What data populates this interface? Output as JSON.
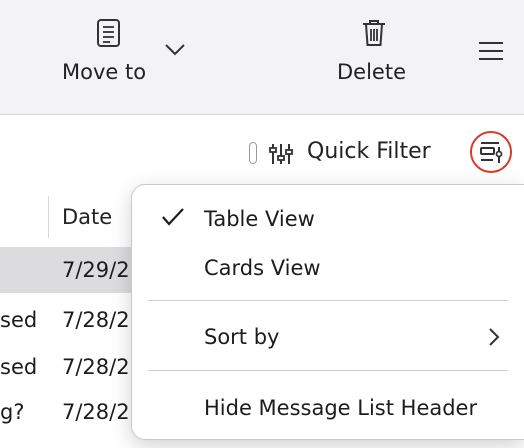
{
  "toolbar": {
    "move_to_label": "Move to",
    "delete_label": "Delete"
  },
  "filter_bar": {
    "quick_filter_label": "Quick Filter"
  },
  "message_list": {
    "columns": {
      "date": "Date"
    },
    "rows": [
      {
        "subject_fragment": "",
        "date_fragment": "7/29/2",
        "selected": true
      },
      {
        "subject_fragment": "sed",
        "date_fragment": "7/28/2",
        "selected": false
      },
      {
        "subject_fragment": "sed",
        "date_fragment": "7/28/2",
        "selected": false
      },
      {
        "subject_fragment": "g?",
        "date_fragment": "7/28/2",
        "selected": false
      }
    ]
  },
  "view_menu": {
    "items": [
      {
        "label": "Table View",
        "checked": true
      },
      {
        "label": "Cards View",
        "checked": false
      },
      {
        "label": "Sort by",
        "has_submenu": true
      },
      {
        "label": "Hide Message List Header"
      }
    ]
  },
  "colors": {
    "toolbar_bg": "#f3f3f5",
    "selected_row": "#dcdcde",
    "highlight_ring": "#d93b2b"
  }
}
